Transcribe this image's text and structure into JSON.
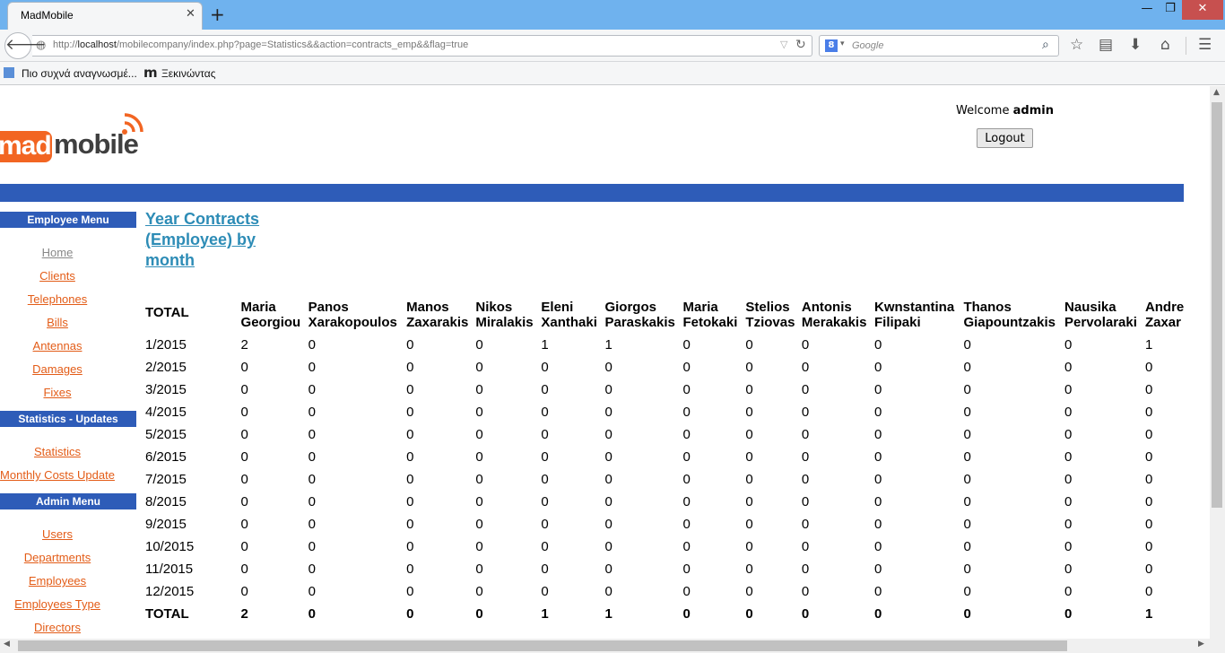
{
  "browser": {
    "tab_title": "MadMobile",
    "tab_close": "✕",
    "new_tab": "+",
    "url_prefix": "http://",
    "url_host": "localhost",
    "url_path": "/mobilecompany/index.php?page=Statistics&&action=contracts_emp&&flag=true",
    "search_placeholder": "Google",
    "bookmark_1": "Πιο συχνά αναγνωσμέ...",
    "bookmark_2": "Ξεκινώντας"
  },
  "header": {
    "logo_mad": "mad",
    "logo_mobile": "mobile",
    "welcome_prefix": "Welcome",
    "username": "admin",
    "logout_label": "Logout"
  },
  "sidebar": {
    "employee_menu_title": "Employee Menu",
    "employee_items": [
      "Home",
      "Clients",
      "Telephones",
      "Bills",
      "Antennas",
      "Damages",
      "Fixes"
    ],
    "statistics_menu_title": "Statistics - Updates",
    "statistics_items": [
      "Statistics",
      "Monthly Costs Update"
    ],
    "admin_menu_title": "Admin Menu",
    "admin_items": [
      "Users",
      "Departments",
      "Employees",
      "Employees Type",
      "Directors"
    ]
  },
  "main": {
    "heading": "Year Contracts (Employee) by month",
    "total_header": "TOTAL",
    "total_row_label": "TOTAL",
    "employees": [
      [
        "Maria",
        "Georgiou"
      ],
      [
        "Panos",
        "Xarakopoulos"
      ],
      [
        "Manos",
        "Zaxarakis"
      ],
      [
        "Nikos",
        "Miralakis"
      ],
      [
        "Eleni",
        "Xanthaki"
      ],
      [
        "Giorgos",
        "Paraskakis"
      ],
      [
        "Maria",
        "Fetokaki"
      ],
      [
        "Stelios",
        "Tziovas"
      ],
      [
        "Antonis",
        "Merakakis"
      ],
      [
        "Kwnstantina",
        "Filipaki"
      ],
      [
        "Thanos",
        "Giapountzakis"
      ],
      [
        "Nausika",
        "Pervolaraki"
      ],
      [
        "Andre",
        "Zaxar"
      ]
    ],
    "months": [
      "1/2015",
      "2/2015",
      "3/2015",
      "4/2015",
      "5/2015",
      "6/2015",
      "7/2015",
      "8/2015",
      "9/2015",
      "10/2015",
      "11/2015",
      "12/2015"
    ],
    "values": [
      [
        "2",
        "0",
        "0",
        "0",
        "1",
        "1",
        "0",
        "0",
        "0",
        "0",
        "0",
        "0",
        "1"
      ],
      [
        "0",
        "0",
        "0",
        "0",
        "0",
        "0",
        "0",
        "0",
        "0",
        "0",
        "0",
        "0",
        "0"
      ],
      [
        "0",
        "0",
        "0",
        "0",
        "0",
        "0",
        "0",
        "0",
        "0",
        "0",
        "0",
        "0",
        "0"
      ],
      [
        "0",
        "0",
        "0",
        "0",
        "0",
        "0",
        "0",
        "0",
        "0",
        "0",
        "0",
        "0",
        "0"
      ],
      [
        "0",
        "0",
        "0",
        "0",
        "0",
        "0",
        "0",
        "0",
        "0",
        "0",
        "0",
        "0",
        "0"
      ],
      [
        "0",
        "0",
        "0",
        "0",
        "0",
        "0",
        "0",
        "0",
        "0",
        "0",
        "0",
        "0",
        "0"
      ],
      [
        "0",
        "0",
        "0",
        "0",
        "0",
        "0",
        "0",
        "0",
        "0",
        "0",
        "0",
        "0",
        "0"
      ],
      [
        "0",
        "0",
        "0",
        "0",
        "0",
        "0",
        "0",
        "0",
        "0",
        "0",
        "0",
        "0",
        "0"
      ],
      [
        "0",
        "0",
        "0",
        "0",
        "0",
        "0",
        "0",
        "0",
        "0",
        "0",
        "0",
        "0",
        "0"
      ],
      [
        "0",
        "0",
        "0",
        "0",
        "0",
        "0",
        "0",
        "0",
        "0",
        "0",
        "0",
        "0",
        "0"
      ],
      [
        "0",
        "0",
        "0",
        "0",
        "0",
        "0",
        "0",
        "0",
        "0",
        "0",
        "0",
        "0",
        "0"
      ],
      [
        "0",
        "0",
        "0",
        "0",
        "0",
        "0",
        "0",
        "0",
        "0",
        "0",
        "0",
        "0",
        "0"
      ]
    ],
    "totals": [
      "2",
      "0",
      "0",
      "0",
      "1",
      "1",
      "0",
      "0",
      "0",
      "0",
      "0",
      "0",
      "1"
    ]
  },
  "colors": {
    "brand_orange": "#f26522",
    "menu_blue": "#2e5cb8",
    "link_orange": "#e35c17",
    "heading_blue": "#2d8cb6"
  }
}
